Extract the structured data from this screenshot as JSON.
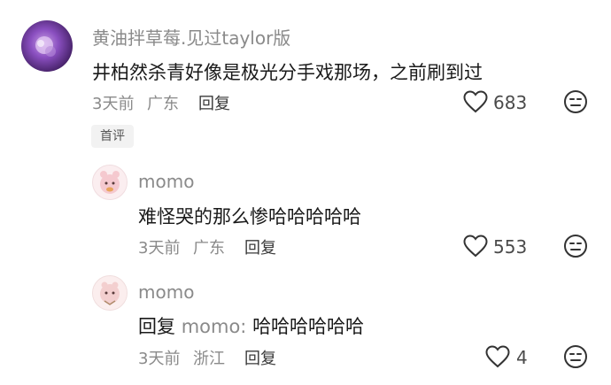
{
  "comments": [
    {
      "username": "黄油拌草莓.见过taylor版",
      "text": "井柏然杀青好像是极光分手戏那场，之前刷到过",
      "time": "3天前",
      "location": "广东",
      "reply_label": "回复",
      "likes": "683",
      "tag": "首评"
    },
    {
      "username": "momo",
      "text": "难怪哭的那么惨哈哈哈哈哈",
      "time": "3天前",
      "location": "广东",
      "reply_label": "回复",
      "likes": "553"
    },
    {
      "username": "momo",
      "reply_prefix": "回复",
      "reply_target": "momo:",
      "text": "哈哈哈哈哈哈",
      "time": "3天前",
      "location": "浙江",
      "reply_label": "回复",
      "likes": "4"
    }
  ],
  "icons": {
    "like": "heart-icon",
    "reaction": "neutral-face-icon"
  }
}
